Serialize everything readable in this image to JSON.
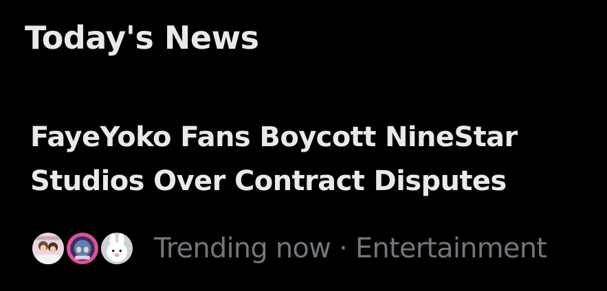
{
  "section": {
    "title": "Today's News"
  },
  "story": {
    "headline": "FayeYoko Fans Boycott NineStar Studios Over Contract Disputes",
    "status": "Trending now",
    "separator": "·",
    "category": "Entertainment",
    "avatars": [
      {
        "icon": "fan-avatar-photo-1"
      },
      {
        "icon": "fan-avatar-photo-2"
      },
      {
        "icon": "fan-avatar-bunny"
      }
    ]
  },
  "colors": {
    "background": "#000000",
    "primary_text": "#e7e9ea",
    "secondary_text": "#71767b"
  }
}
